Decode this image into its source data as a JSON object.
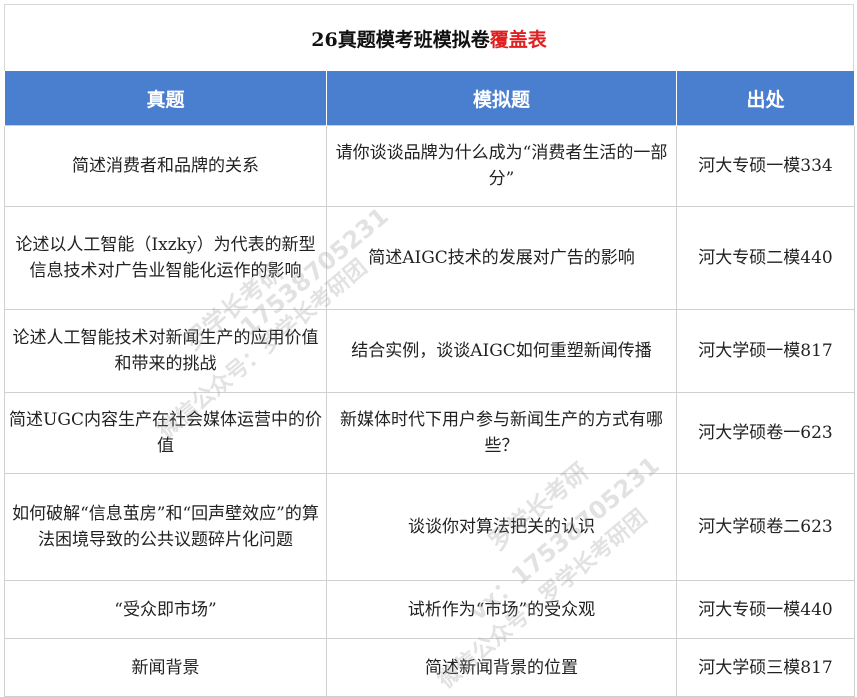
{
  "title": {
    "main": "26真题模考班模拟卷",
    "highlight": "覆盖表",
    "highlight_color": "#e02020"
  },
  "header_color": "#4a7fd0",
  "columns": [
    "真题",
    "模拟题",
    "出处"
  ],
  "rows": [
    {
      "real": "简述消费者和品牌的关系",
      "mock": "请你谈谈品牌为什么成为“消费者生活的一部分”",
      "source": "河大专硕一模334"
    },
    {
      "real": "论述以人工智能（Ixzky）为代表的新型信息技术对广告业智能化运作的影响",
      "mock": "简述AIGC技术的发展对广告的影响",
      "source": "河大专硕二模440"
    },
    {
      "real": "论述人工智能技术对新闻生产的应用价值和带来的挑战",
      "mock": "结合实例，谈谈AIGC如何重塑新闻传播",
      "source": "河大学硕一模817"
    },
    {
      "real": "简述UGC内容生产在社会媒体运营中的价值",
      "mock": "新媒体时代下用户参与新闻生产的方式有哪些？",
      "source": "河大学硕卷一623"
    },
    {
      "real": "如何破解“信息茧房”和“回声壁效应”的算法困境导致的公共议题碎片化问题",
      "mock": "谈谈你对算法把关的认识",
      "source": "河大学硕卷二623"
    },
    {
      "real": "“受众即市场”",
      "mock": "试析作为“市场”的受众观",
      "source": "河大专硕一模440"
    },
    {
      "real": "新闻背景",
      "mock": "简述新闻背景的位置",
      "source": "河大学硕三模817"
    }
  ],
  "watermarks": {
    "a": "罗学长考研",
    "b": "17538705231",
    "c": "微信公众号：罗学长考研团",
    "d": "vx：17538705231"
  }
}
